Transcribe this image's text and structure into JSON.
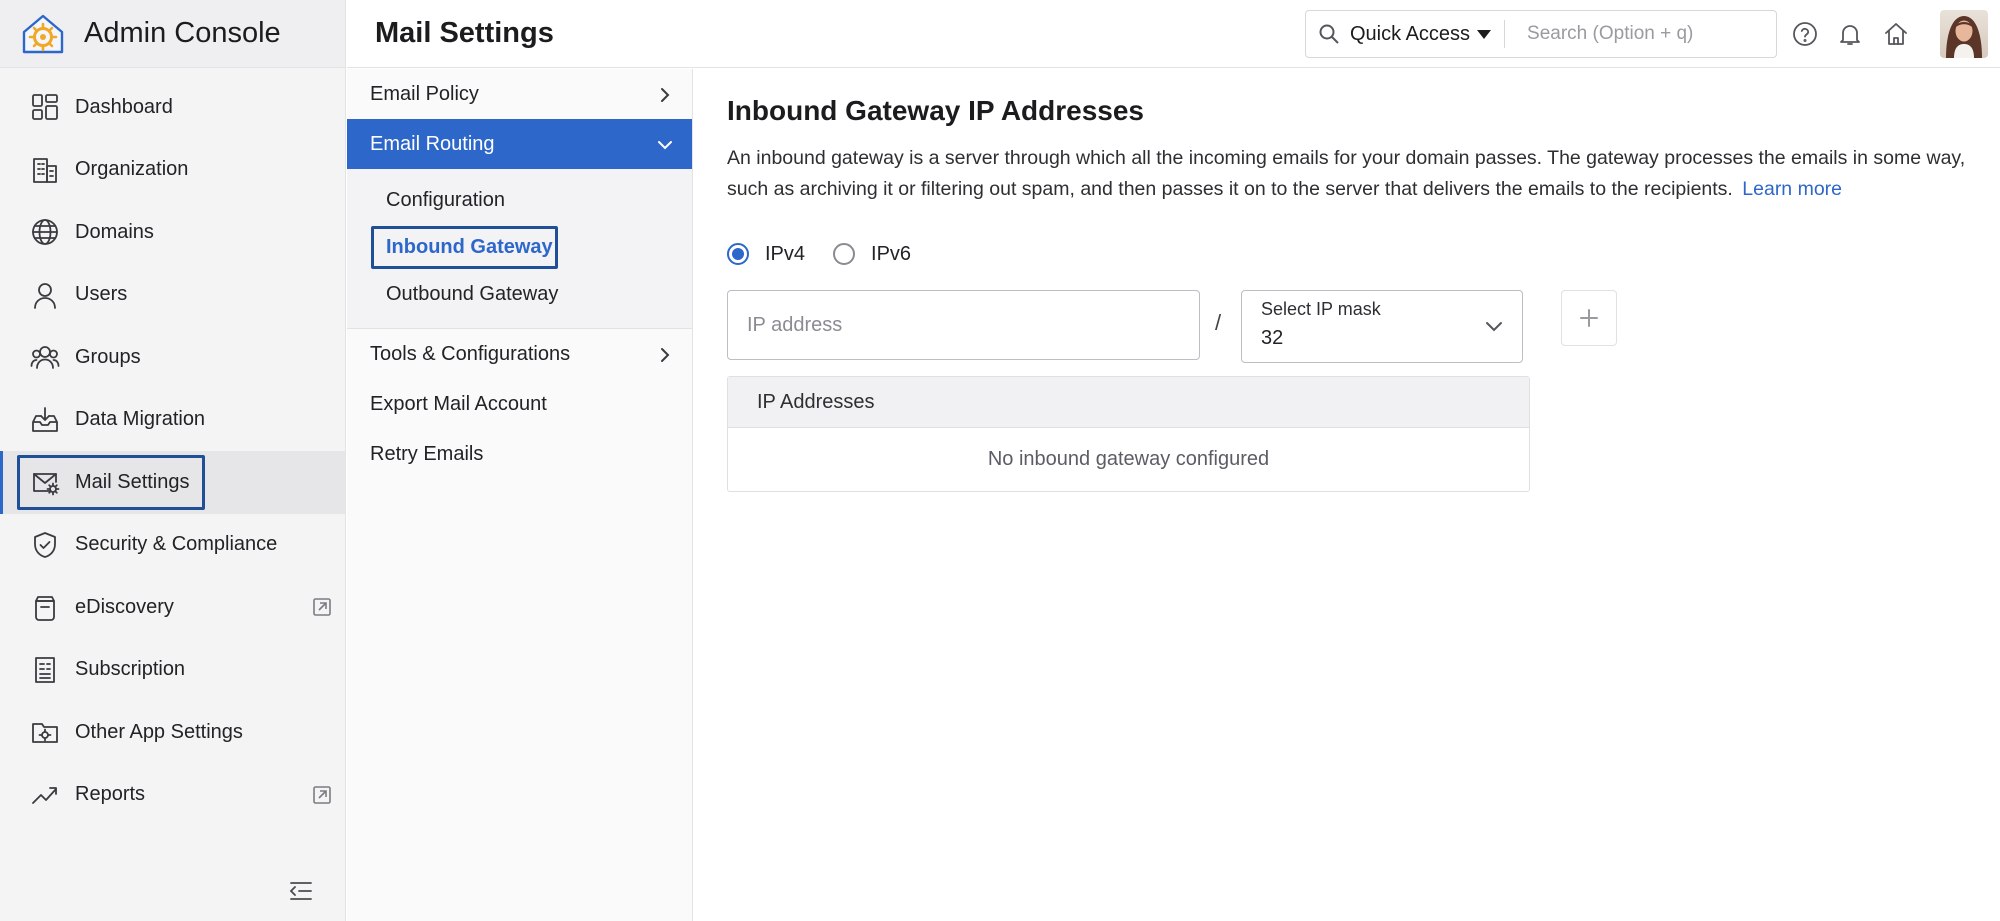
{
  "app": {
    "title": "Admin Console"
  },
  "sidebar": {
    "items": [
      {
        "label": "Dashboard",
        "icon": "dashboard-icon"
      },
      {
        "label": "Organization",
        "icon": "building-icon"
      },
      {
        "label": "Domains",
        "icon": "globe-icon"
      },
      {
        "label": "Users",
        "icon": "user-icon"
      },
      {
        "label": "Groups",
        "icon": "group-icon"
      },
      {
        "label": "Data Migration",
        "icon": "inbox-download-icon"
      },
      {
        "label": "Mail Settings",
        "icon": "mail-gear-icon",
        "active": true
      },
      {
        "label": "Security & Compliance",
        "icon": "shield-icon"
      },
      {
        "label": "eDiscovery",
        "icon": "archive-icon",
        "external": true
      },
      {
        "label": "Subscription",
        "icon": "invoice-icon"
      },
      {
        "label": "Other App Settings",
        "icon": "folder-gear-icon"
      },
      {
        "label": "Reports",
        "icon": "trend-icon",
        "external": true
      }
    ]
  },
  "header": {
    "title": "Mail Settings",
    "quick_access_label": "Quick Access",
    "search_placeholder": "Search (Option + q)"
  },
  "subnav": {
    "email_policy": "Email Policy",
    "email_routing": "Email Routing",
    "children": [
      "Configuration",
      "Inbound Gateway",
      "Outbound Gateway"
    ],
    "tools": "Tools & Configurations",
    "export": "Export Mail Account",
    "retry": "Retry Emails"
  },
  "main": {
    "title": "Inbound Gateway IP Addresses",
    "description": "An inbound gateway is a server through which all the incoming emails for your domain passes. The gateway processes the emails in some way, such as archiving it or filtering out spam, and then passes it on to the server that delivers the emails to the recipients.",
    "learn_more": "Learn more",
    "radio_ipv4": "IPv4",
    "radio_ipv6": "IPv6",
    "selected_ip_version": "IPv4",
    "ip_placeholder": "IP address",
    "slash": "/",
    "mask_label": "Select IP mask",
    "mask_value": "32",
    "table_header": "IP Addresses",
    "table_empty": "No inbound gateway configured"
  },
  "colors": {
    "accent": "#2d67c9",
    "focus": "#1f4f96"
  }
}
